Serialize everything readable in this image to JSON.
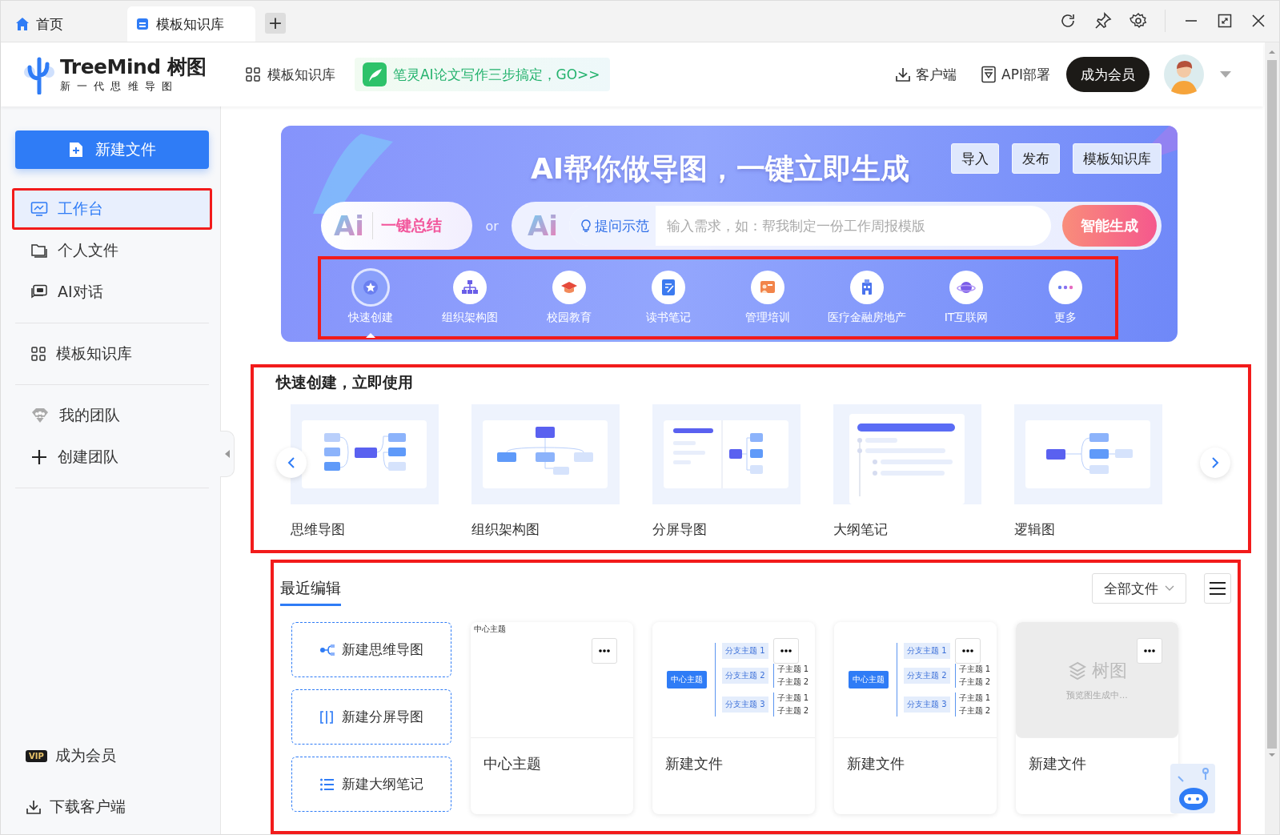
{
  "tabs": [
    {
      "label": "首页",
      "kind": "home",
      "selected": false
    },
    {
      "label": "模板知识库",
      "kind": "template",
      "selected": true
    }
  ],
  "new_tab": "+",
  "header": {
    "brand": "TreeMind",
    "brand_cn": "树图",
    "slogan": "新 一 代 思 维 导 图",
    "nav_link": "模板知识库",
    "promo": "笔灵AI论文写作三步搞定，GO>>",
    "actions": [
      {
        "label": "客户端",
        "kind": "download"
      },
      {
        "label": "API部署",
        "kind": "api"
      }
    ],
    "member_button": "成为会员"
  },
  "sidebar": {
    "new_button": "新建文件",
    "groups": [
      [
        {
          "label": "工作台",
          "kind": "monitor",
          "selected": true,
          "highlighted": true
        },
        {
          "label": "个人文件",
          "kind": "folder",
          "selected": false,
          "highlighted": false
        },
        {
          "label": "AI对话",
          "kind": "chat",
          "selected": false,
          "highlighted": false
        }
      ],
      [
        {
          "label": "模板知识库",
          "kind": "grid",
          "selected": false,
          "highlighted": false
        }
      ],
      [
        {
          "label": "我的团队",
          "kind": "team",
          "selected": false,
          "highlighted": false
        },
        {
          "label": "创建团队",
          "kind": "plus",
          "selected": false,
          "highlighted": false
        }
      ]
    ],
    "bottom": [
      {
        "label": "成为会员",
        "kind": "vip",
        "badge": "VIP"
      },
      {
        "label": "下载客户端",
        "kind": "download"
      }
    ]
  },
  "banner": {
    "title": "AI帮你做导图，一键立即生成",
    "buttons": [
      "导入",
      "发布",
      "模板知识库"
    ],
    "summary_logo": "Ai",
    "summary_label": "一键总结",
    "or": "or",
    "ai_logo": "Ai",
    "prompt_hint": "提问示范",
    "placeholder": "输入需求，如：帮我制定一份工作周报模版",
    "generate_button": "智能生成",
    "categories_highlighted": true,
    "categories": [
      {
        "label": "快速创建",
        "kind": "star",
        "selected": true
      },
      {
        "label": "组织架构图",
        "kind": "org",
        "selected": false
      },
      {
        "label": "校园教育",
        "kind": "cap",
        "selected": false
      },
      {
        "label": "读书笔记",
        "kind": "note",
        "selected": false
      },
      {
        "label": "管理培训",
        "kind": "board",
        "selected": false
      },
      {
        "label": "医疗金融房地产",
        "kind": "building",
        "selected": false
      },
      {
        "label": "IT互联网",
        "kind": "planet",
        "selected": false
      },
      {
        "label": "更多",
        "kind": "more",
        "selected": false
      }
    ]
  },
  "quick_create": {
    "highlighted": true,
    "title": "快速创建，立即使用",
    "templates": [
      {
        "label": "思维导图",
        "kind": "mindmap"
      },
      {
        "label": "组织架构图",
        "kind": "org"
      },
      {
        "label": "分屏导图",
        "kind": "split"
      },
      {
        "label": "大纲笔记",
        "kind": "outline"
      },
      {
        "label": "逻辑图",
        "kind": "logic"
      }
    ]
  },
  "recent": {
    "highlighted": true,
    "tabs": [
      {
        "label": "最近编辑",
        "selected": true
      }
    ],
    "filter": "全部文件",
    "new_actions": [
      {
        "label": "新建思维导图",
        "kind": "mindmap"
      },
      {
        "label": "新建分屏导图",
        "kind": "split"
      },
      {
        "label": "新建大纲笔记",
        "kind": "outline"
      }
    ],
    "files": [
      {
        "name": "中心主题",
        "preview": {
          "kind": "blank",
          "title": "中心主题"
        }
      },
      {
        "name": "新建文件",
        "preview": {
          "kind": "mindmap",
          "center": "中心主题",
          "branches": [
            {
              "label": "分支主题 1"
            },
            {
              "label": "分支主题 2",
              "children": [
                "子主题 1",
                "子主题 2"
              ]
            },
            {
              "label": "分支主题 3",
              "children": [
                "子主题 1",
                "子主题 2"
              ]
            }
          ]
        }
      },
      {
        "name": "新建文件",
        "preview": {
          "kind": "mindmap",
          "center": "中心主题",
          "branches": [
            {
              "label": "分支主题 1"
            },
            {
              "label": "分支主题 2",
              "children": [
                "子主题 1",
                "子主题 2"
              ]
            },
            {
              "label": "分支主题 3",
              "children": [
                "子主题 1",
                "子主题 2"
              ]
            }
          ]
        }
      },
      {
        "name": "新建文件",
        "preview": {
          "kind": "pending",
          "logo": "树图",
          "text": "预览图生成中..."
        }
      }
    ]
  }
}
